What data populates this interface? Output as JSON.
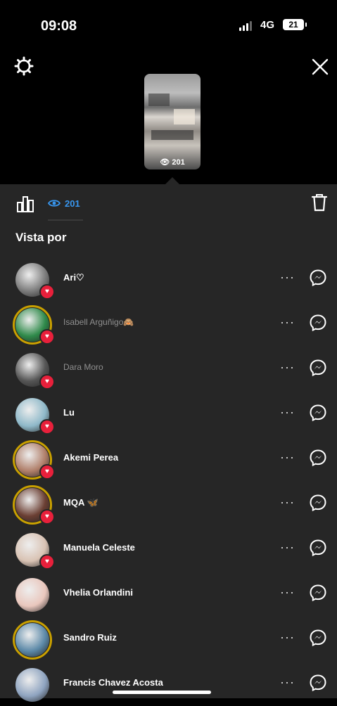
{
  "status_bar": {
    "time": "09:08",
    "network": "4G",
    "battery": "21"
  },
  "header": {
    "settings_icon": "gear-icon",
    "close_icon": "close-icon",
    "story_view_count": "201"
  },
  "tabs": {
    "insights_icon": "bar-chart-icon",
    "views_count": "201",
    "delete_icon": "trash-icon"
  },
  "section_title": "Vista por",
  "viewers": [
    {
      "name": "Ari♡",
      "muted": false,
      "ring": false,
      "liked": true,
      "avatar": "#7d7d7d"
    },
    {
      "name": "Isabell Arguñigo🙈",
      "muted": true,
      "ring": true,
      "liked": true,
      "avatar": "#2f8a4a"
    },
    {
      "name": "Dara Moro",
      "muted": true,
      "ring": false,
      "liked": true,
      "avatar": "#555"
    },
    {
      "name": "Lu",
      "muted": false,
      "ring": false,
      "liked": true,
      "avatar": "#8fb9c9"
    },
    {
      "name": "Akemi Perea",
      "muted": false,
      "ring": true,
      "liked": true,
      "avatar": "#b07f6a"
    },
    {
      "name": "MQA 🦋",
      "muted": false,
      "ring": true,
      "liked": true,
      "avatar": "#6b3f33"
    },
    {
      "name": "Manuela Celeste",
      "muted": false,
      "ring": false,
      "liked": true,
      "avatar": "#d9c3b4"
    },
    {
      "name": "Vhelia Orlandini",
      "muted": false,
      "ring": false,
      "liked": false,
      "avatar": "#e9c7bd"
    },
    {
      "name": "Sandro Ruiz",
      "muted": false,
      "ring": true,
      "liked": false,
      "avatar": "#5c89a8"
    },
    {
      "name": "Francis Chavez Acosta",
      "muted": false,
      "ring": false,
      "liked": false,
      "avatar": "#8fa4c0"
    }
  ],
  "row_actions": {
    "more_label": "···",
    "message_icon": "messenger-icon"
  },
  "colors": {
    "accent": "#3897f0",
    "like": "#e8203b",
    "sheet_bg": "#262626"
  }
}
